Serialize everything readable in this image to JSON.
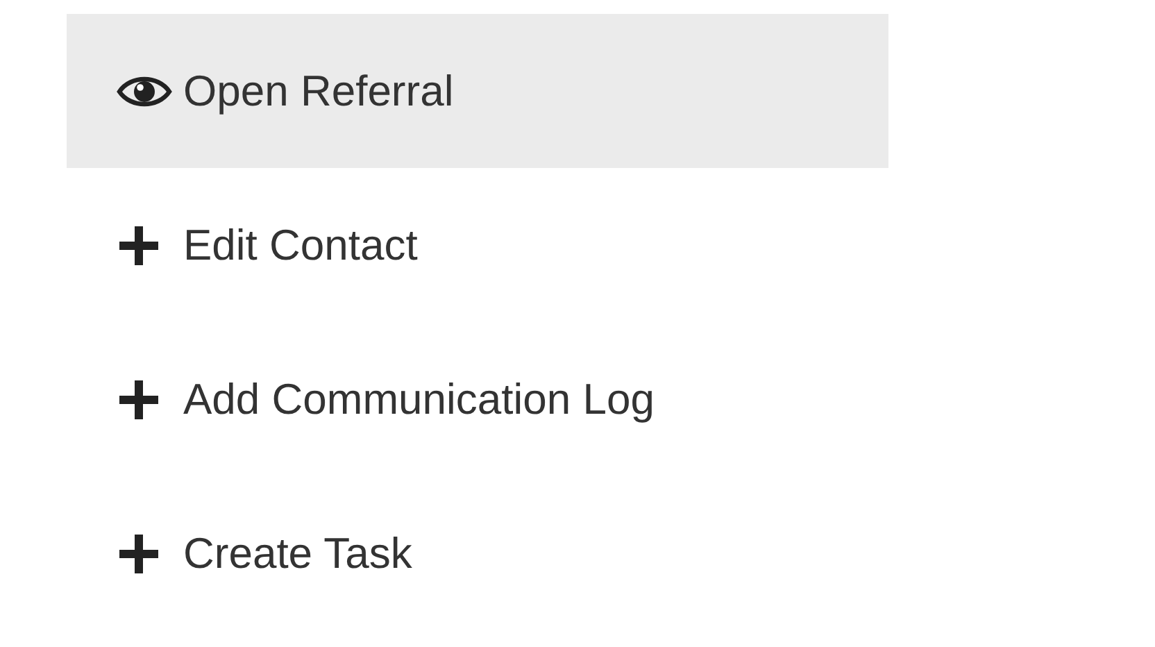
{
  "menu": {
    "items": [
      {
        "label": "Open Referral",
        "kind": "view",
        "selected": true
      },
      {
        "label": "Edit Contact",
        "kind": "add",
        "selected": false
      },
      {
        "label": "Add Communication Log",
        "kind": "add",
        "selected": false
      },
      {
        "label": "Create Task",
        "kind": "add",
        "selected": false
      }
    ]
  }
}
